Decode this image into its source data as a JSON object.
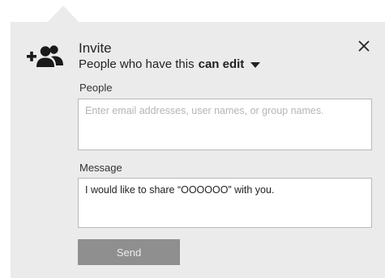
{
  "dialog": {
    "title": "Invite",
    "permission": {
      "prefix": "People who have this",
      "value": "can edit"
    },
    "icons": {
      "invite": "add-people-icon",
      "close": "close-icon",
      "dropdown": "caret-down-icon"
    }
  },
  "people": {
    "label": "People",
    "placeholder": "Enter email addresses, user names, or group names.",
    "value": ""
  },
  "message": {
    "label": "Message",
    "value": "I would like to share “OOOOOO” with you."
  },
  "actions": {
    "send_label": "Send"
  },
  "colors": {
    "panel_background": "#ebebeb",
    "send_button": "#8f8f8f",
    "field_border": "#b9b9b9"
  }
}
